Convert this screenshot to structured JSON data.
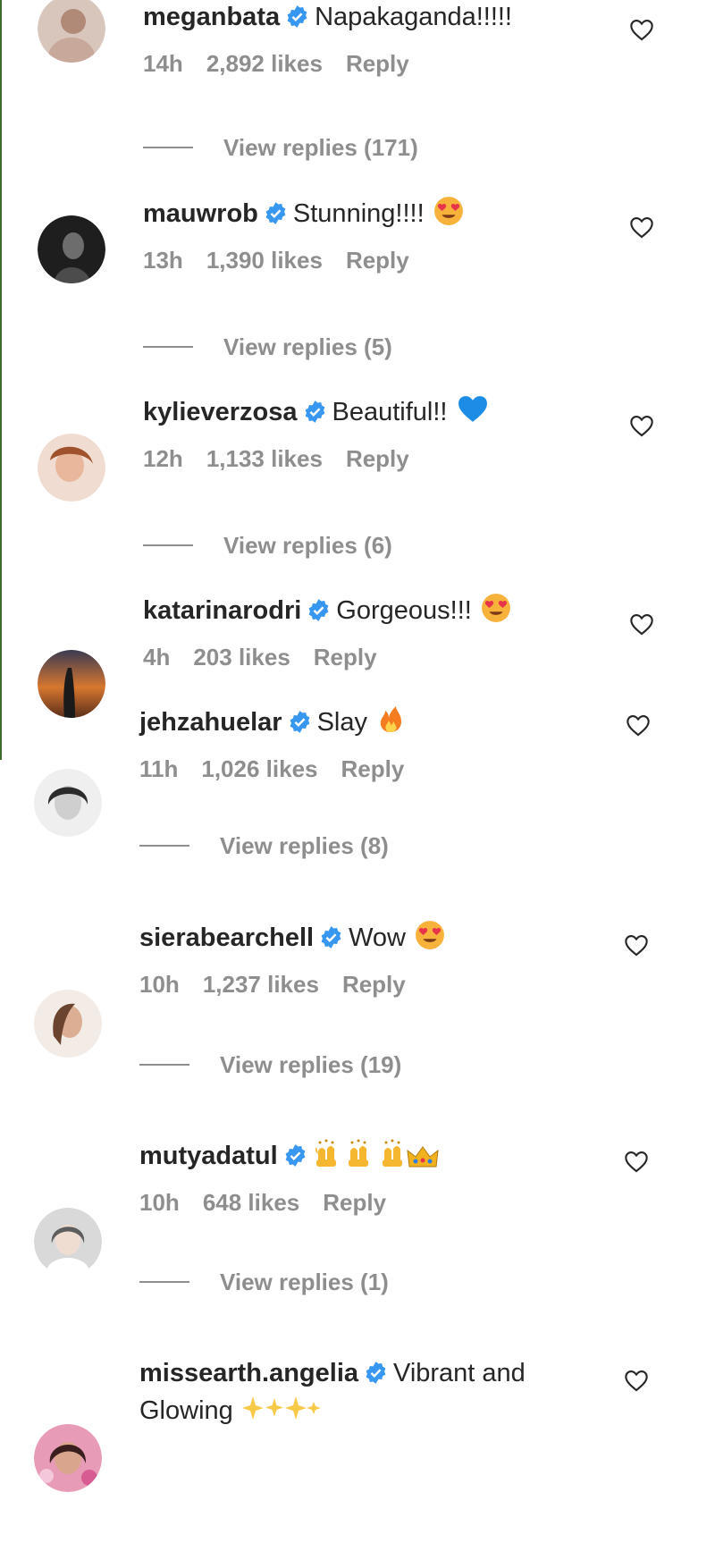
{
  "comments": [
    {
      "username": "meganbata",
      "text": "Napakaganda!!!!!",
      "emoji": "",
      "time": "14h",
      "likes": "2,892 likes",
      "reply": "Reply",
      "view_replies": "View replies (171)",
      "avatar_color": "#c9b3a8"
    },
    {
      "username": "mauwrob",
      "text": "Stunning!!!!",
      "emoji": "heart-eyes-emoji",
      "time": "13h",
      "likes": "1,390 likes",
      "reply": "Reply",
      "view_replies": "View replies (5)",
      "avatar_color": "#2a2a2a"
    },
    {
      "username": "kylieverzosa",
      "text": "Beautiful!!",
      "emoji": "blue-heart-emoji",
      "time": "12h",
      "likes": "1,133 likes",
      "reply": "Reply",
      "view_replies": "View replies (6)",
      "avatar_color": "#e7c6b3"
    },
    {
      "username": "katarinarodri",
      "text": "Gorgeous!!!",
      "emoji": "heart-eyes-emoji",
      "time": "4h",
      "likes": "203 likes",
      "reply": "Reply",
      "view_replies": "",
      "avatar_color": "#c2672e"
    },
    {
      "username": "jehzahuelar",
      "text": "Slay",
      "emoji": "fire-emoji",
      "time": "11h",
      "likes": "1,026 likes",
      "reply": "Reply",
      "view_replies": "View replies (8)",
      "avatar_color": "#4a4a4a"
    },
    {
      "username": "sierabearchell",
      "text": "Wow",
      "emoji": "heart-eyes-emoji",
      "time": "10h",
      "likes": "1,237 likes",
      "reply": "Reply",
      "view_replies": "View replies (19)",
      "avatar_color": "#c9a48e"
    },
    {
      "username": "mutyadatul",
      "text": "",
      "emoji": "raised-hands-crown-emoji",
      "time": "10h",
      "likes": "648 likes",
      "reply": "Reply",
      "view_replies": "View replies (1)",
      "avatar_color": "#a9a9a9"
    },
    {
      "username": "missearth.angelia",
      "text": "Vibrant and Glowing",
      "emoji": "sparkles-emoji",
      "time": "",
      "likes": "",
      "reply": "",
      "view_replies": "",
      "avatar_color": "#c96a8e"
    }
  ],
  "colors": {
    "verified": "#3897f0",
    "meta_text": "#8e8e8e",
    "primary_text": "#262626"
  },
  "icons": {
    "verified": "verified-badge-icon",
    "like": "heart-outline-icon"
  }
}
